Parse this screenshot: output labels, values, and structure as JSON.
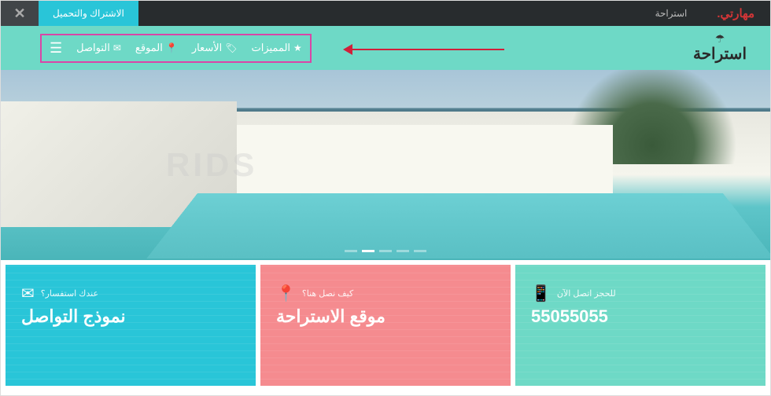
{
  "topbar": {
    "subscribe_label": "الاشتراك والتحميل",
    "link_label": "استراحة",
    "brand": "مهارتي."
  },
  "nav": {
    "logo": "استراحة",
    "items": [
      {
        "icon": "★",
        "label": "المميزات"
      },
      {
        "icon": "🏷",
        "label": "الأسعار"
      },
      {
        "icon": "📍",
        "label": "الموقع"
      },
      {
        "icon": "✉",
        "label": "التواصل"
      }
    ]
  },
  "hero": {
    "watermark": "RIDS"
  },
  "cards": [
    {
      "label": "للحجز اتصل الآن",
      "title": "55055055",
      "icon": "📱",
      "class": "card-teal"
    },
    {
      "label": "كيف نصل هنا؟",
      "title": "موقع الاستراحة",
      "icon": "📍",
      "class": "card-coral"
    },
    {
      "label": "عندك استفسار؟",
      "title": "نموذج التواصل",
      "icon": "✉",
      "class": "card-cyan"
    }
  ]
}
